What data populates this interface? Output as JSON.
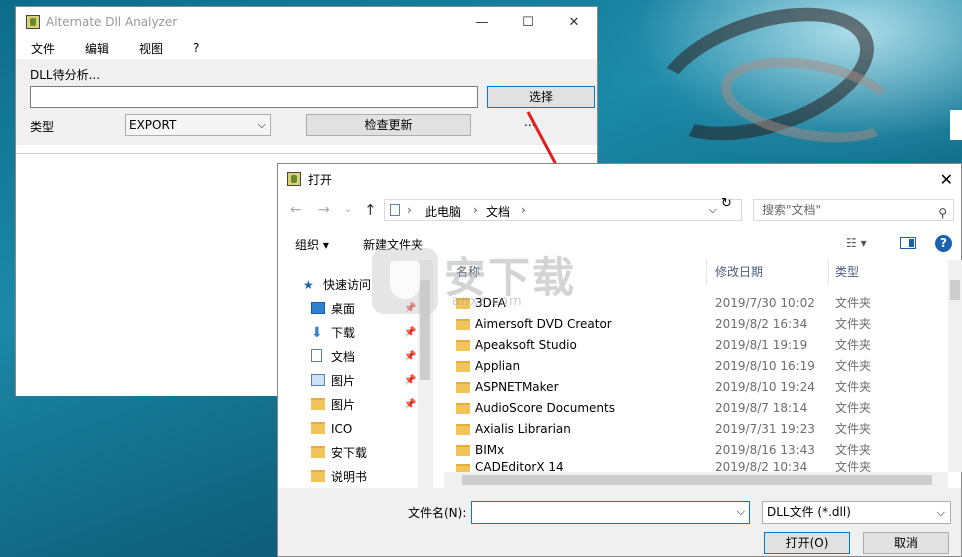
{
  "main_window": {
    "title": "Alternate Dll Analyzer",
    "controls": {
      "minimize": "—",
      "maximize": "☐",
      "close": "✕"
    },
    "menu": [
      "文件",
      "编辑",
      "视图",
      "?"
    ],
    "dll_label": "DLL待分析...",
    "path_value": "",
    "select_button": "选择",
    "type_label": "类型",
    "type_selected": "EXPORT",
    "update_button": "检查更新",
    "more_button": "..."
  },
  "dialog": {
    "title": "打开",
    "close": "✕",
    "breadcrumb": [
      "此电脑",
      "文档"
    ],
    "search_placeholder": "搜索\"文档\"",
    "toolbar": {
      "organize": "组织 ▾",
      "new_folder": "新建文件夹"
    },
    "sidebar": [
      {
        "label": "快速访问",
        "icon": "star-icon",
        "pinned": false
      },
      {
        "label": "桌面",
        "icon": "desktop-icon",
        "pinned": true
      },
      {
        "label": "下载",
        "icon": "download-icon",
        "pinned": true
      },
      {
        "label": "文档",
        "icon": "document-icon",
        "pinned": true
      },
      {
        "label": "图片",
        "icon": "picture-icon",
        "pinned": true
      },
      {
        "label": "图片",
        "icon": "folder-icon",
        "pinned": true
      },
      {
        "label": "ICO",
        "icon": "folder-icon",
        "pinned": false
      },
      {
        "label": "安下载",
        "icon": "folder-icon",
        "pinned": false
      },
      {
        "label": "说明书",
        "icon": "folder-icon",
        "pinned": false
      }
    ],
    "columns": {
      "name": "名称",
      "modified": "修改日期",
      "type": "类型"
    },
    "files": [
      {
        "name": "3DFA",
        "modified": "2019/7/30 10:02",
        "type": "文件夹"
      },
      {
        "name": "Aimersoft DVD Creator",
        "modified": "2019/8/2 16:34",
        "type": "文件夹"
      },
      {
        "name": "Apeaksoft Studio",
        "modified": "2019/8/1 19:19",
        "type": "文件夹"
      },
      {
        "name": "Applian",
        "modified": "2019/8/10 16:19",
        "type": "文件夹"
      },
      {
        "name": "ASPNETMaker",
        "modified": "2019/8/10 19:24",
        "type": "文件夹"
      },
      {
        "name": "AudioScore Documents",
        "modified": "2019/8/7 18:14",
        "type": "文件夹"
      },
      {
        "name": "Axialis Librarian",
        "modified": "2019/7/31 19:23",
        "type": "文件夹"
      },
      {
        "name": "BIMx",
        "modified": "2019/8/16 13:43",
        "type": "文件夹"
      },
      {
        "name": "CADEditorX 14",
        "modified": "2019/8/2 10:34",
        "type": "文件夹"
      }
    ],
    "filename_label": "文件名(N):",
    "filename_value": "",
    "filter_selected": "DLL文件 (*.dll)",
    "open_button": "打开(O)",
    "cancel_button": "取消"
  },
  "watermark": {
    "text": "安下载",
    "sub": "anxz.com"
  }
}
